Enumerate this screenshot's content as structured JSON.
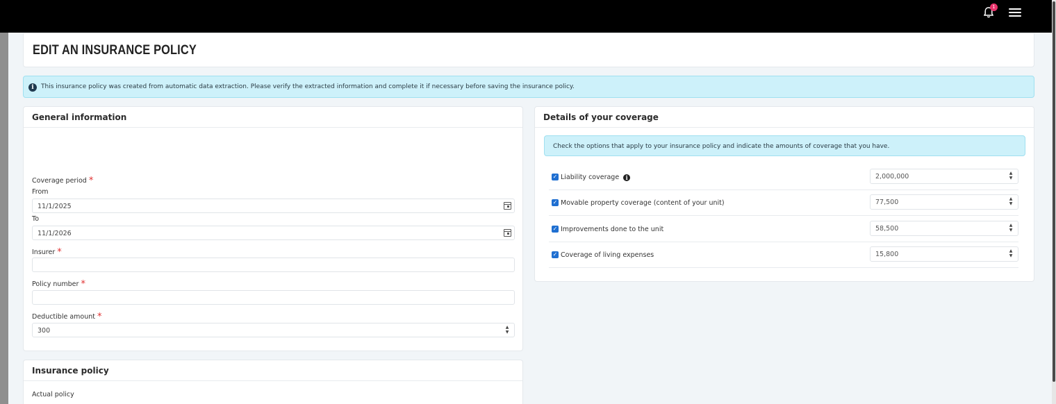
{
  "topbar": {
    "notification_count": "1",
    "icons": [
      "bell-icon",
      "hamburger-menu-icon"
    ]
  },
  "page": {
    "title": "EDIT AN INSURANCE POLICY"
  },
  "alert": {
    "message": "This insurance policy was created from automatic data extraction. Please verify the extracted information and complete it if necessary before saving the insurance policy."
  },
  "general": {
    "title": "General information",
    "coverage_period_label": "Coverage period",
    "from_label": "From",
    "from_value": "11/1/2025",
    "to_label": "To",
    "to_value": "11/1/2026",
    "insurer_label": "Insurer",
    "insurer_value": "",
    "policy_number_label": "Policy number",
    "policy_number_value": "",
    "deductible_label": "Deductible amount",
    "deductible_value": "300",
    "required_mark": "*"
  },
  "insurance_policy": {
    "title": "Insurance policy",
    "actual_policy_label": "Actual policy"
  },
  "coverage": {
    "title": "Details of your coverage",
    "info": "Check the options that apply to your insurance policy and indicate the amounts of coverage that you have.",
    "items": [
      {
        "label": "Liability coverage",
        "checked": true,
        "value": "2,000,000",
        "has_info": true
      },
      {
        "label": "Movable property coverage (content of your unit)",
        "checked": true,
        "value": "77,500",
        "has_info": false
      },
      {
        "label": "Improvements done to the unit",
        "checked": true,
        "value": "58,500",
        "has_info": false
      },
      {
        "label": "Coverage of living expenses",
        "checked": true,
        "value": "15,800",
        "has_info": false
      }
    ]
  },
  "colors": {
    "topbar": "#000000",
    "alert_bg": "#cdf1fa",
    "required": "#e03131",
    "checkbox": "#1f6fd1",
    "badge": "#e8326a"
  }
}
